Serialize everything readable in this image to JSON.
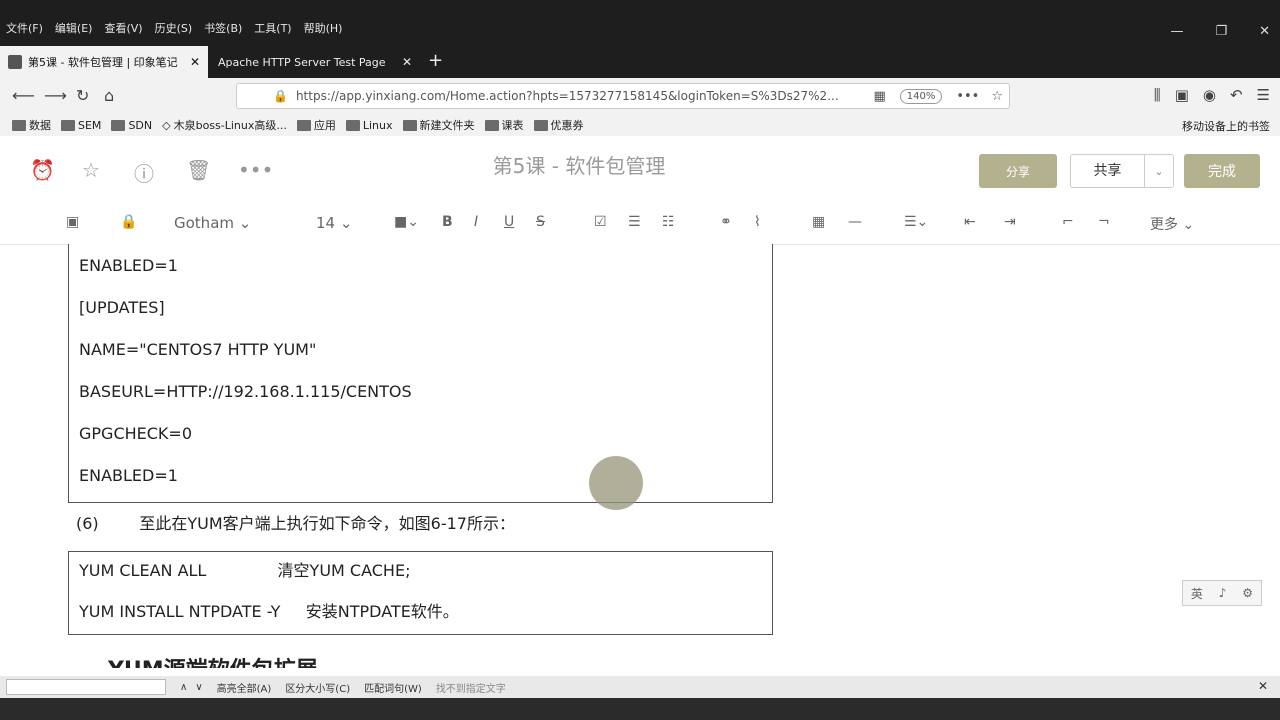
{
  "menu": [
    "文件(F)",
    "编辑(E)",
    "查看(V)",
    "历史(S)",
    "书签(B)",
    "工具(T)",
    "帮助(H)"
  ],
  "window_controls": {
    "minimize": "—",
    "restore": "❐",
    "close": "✕"
  },
  "tabs": [
    {
      "title": "第5课 - 软件包管理 | 印象笔记",
      "close": "✕"
    },
    {
      "title": "Apache HTTP Server Test Page",
      "close": "✕"
    }
  ],
  "new_tab": "+",
  "address": {
    "url": "https://app.yinxiang.com/Home.action?hpts=1573277158145&loginToken=S%3Ds27%2...",
    "zoom": "140%"
  },
  "bookmarks": [
    "数据",
    "SEM",
    "SDN",
    "木泉boss-Linux高级...",
    "应用",
    "Linux",
    "新建文件夹",
    "课表",
    "优惠券"
  ],
  "bookmarks_mobile": "移动设备上的书签",
  "note": {
    "title": "第5课 - 软件包管理",
    "btn_share_outline": "分享",
    "btn_share": "共享",
    "btn_done": "完成"
  },
  "format": {
    "font": "Gotham",
    "size": "14",
    "more": "更多"
  },
  "content": {
    "box1_lines": [
      "ENABLED=1",
      "[UPDATES]",
      "NAME=\"CENTOS7 HTTP YUM\"",
      "BASEURL=HTTP://192.168.1.115/CENTOS",
      "GPGCHECK=0",
      "ENABLED=1"
    ],
    "step": "(6)        至此在YUM客户端上执行如下命令，如图6-17所示：",
    "box2_lines": [
      "YUM CLEAN ALL              清空YUM CACHE;",
      "YUM INSTALL NTPDATE -Y     安装NTPDATE软件。"
    ],
    "heading": "YUM源端软件包扩展"
  },
  "side_widget": [
    "英",
    "♪",
    "⚙"
  ],
  "findbar": {
    "highlight_all": "高亮全部(A)",
    "match_case": "区分大小写(C)",
    "whole_words": "匹配词句(W)",
    "status": "找不到指定文字"
  },
  "colors": {
    "accent": "#b4b18e",
    "chrome": "#1e1e1e"
  }
}
